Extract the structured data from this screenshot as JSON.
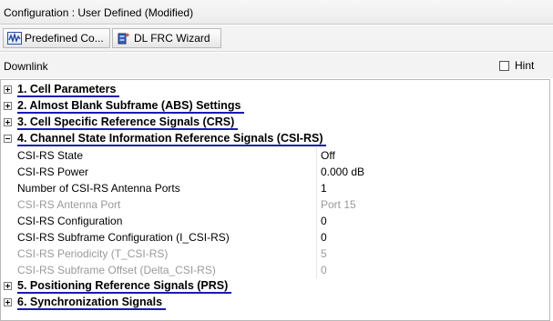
{
  "window": {
    "title": "Configuration : User Defined (Modified)"
  },
  "toolbar": {
    "predefined_label": "Predefined Co...",
    "predefined_icon": "waveform-icon",
    "wizard_label": "DL FRC Wizard",
    "wizard_icon": "wizard-icon"
  },
  "panel": {
    "label": "Downlink",
    "hint_label": "Hint",
    "hint_checked": false
  },
  "tree": {
    "sections": [
      {
        "label": "1. Cell Parameters",
        "expanded": false
      },
      {
        "label": "2. Almost Blank Subframe (ABS) Settings",
        "expanded": false
      },
      {
        "label": "3. Cell Specific Reference Signals (CRS)",
        "expanded": false
      },
      {
        "label": "4. Channel State Information Reference Signals (CSI-RS)",
        "expanded": true
      },
      {
        "label": "5. Positioning Reference Signals (PRS)",
        "expanded": false
      },
      {
        "label": "6. Synchronization Signals",
        "expanded": false
      }
    ],
    "csi_rs": [
      {
        "name": "CSI-RS State",
        "value": "Off",
        "enabled": true
      },
      {
        "name": "CSI-RS Power",
        "value": "0.000 dB",
        "enabled": true
      },
      {
        "name": "Number of CSI-RS Antenna Ports",
        "value": "1",
        "enabled": true
      },
      {
        "name": "CSI-RS Antenna Port",
        "value": "Port 15",
        "enabled": false
      },
      {
        "name": "CSI-RS Configuration",
        "value": "0",
        "enabled": true
      },
      {
        "name": "CSI-RS Subframe Configuration (I_CSI-RS)",
        "value": "0",
        "enabled": true
      },
      {
        "name": "CSI-RS Periodicity (T_CSI-RS)",
        "value": "5",
        "enabled": false
      },
      {
        "name": "CSI-RS Subframe Offset (Delta_CSI-RS)",
        "value": "0",
        "enabled": false
      }
    ]
  }
}
